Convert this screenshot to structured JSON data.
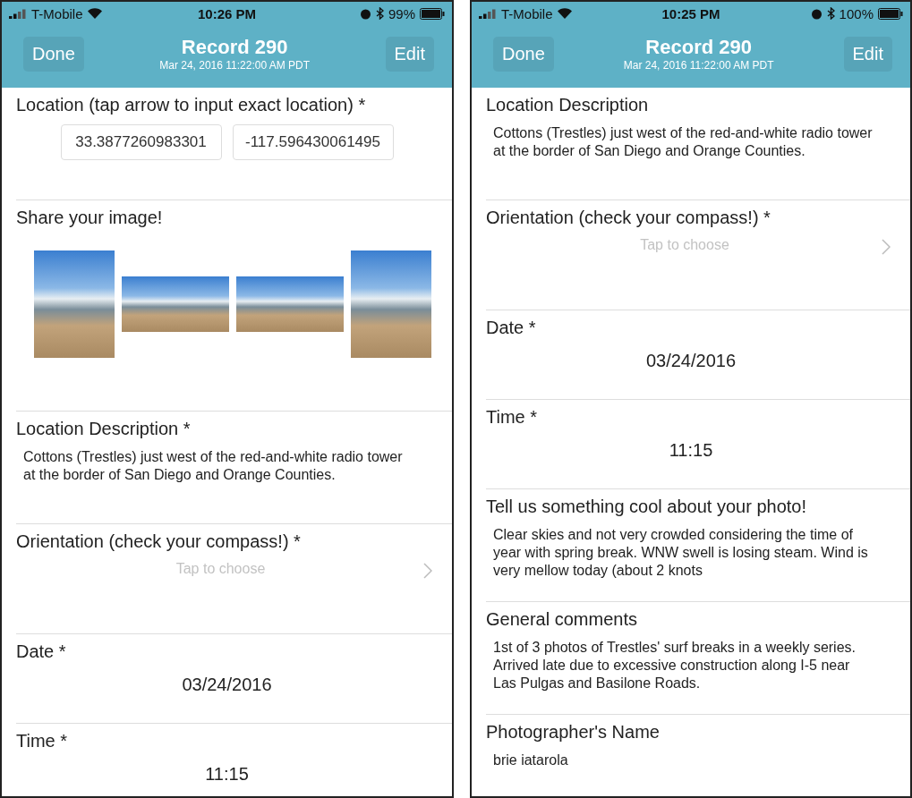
{
  "screens": [
    {
      "status_bar": {
        "carrier": "T-Mobile",
        "time": "10:26 PM",
        "battery": "99%"
      },
      "nav": {
        "left_button": "Done",
        "title": "Record 290",
        "subtitle": "Mar 24, 2016 11:22:00 AM PDT",
        "right_button": "Edit"
      },
      "fields": [
        {
          "kind": "coordinates",
          "label": "Location (tap arrow to input exact location) *",
          "values": [
            "33.3877260983301",
            "-117.596430061495"
          ]
        },
        {
          "kind": "images",
          "label": "Share your image!",
          "images": [
            {
              "kind": "square"
            },
            {
              "kind": "landscape"
            },
            {
              "kind": "landscape"
            },
            {
              "kind": "square"
            }
          ]
        },
        {
          "kind": "text",
          "label": "Location Description *",
          "value": "Cottons (Trestles) just west of the red-and-white radio tower at the border of San Diego and Orange Counties."
        },
        {
          "kind": "picker",
          "label": "Orientation (check your compass!) *",
          "placeholder": "Tap to choose"
        },
        {
          "kind": "value",
          "label": "Date *",
          "value": "03/24/2016"
        },
        {
          "kind": "value",
          "label": "Time *",
          "value": "11:15"
        }
      ]
    },
    {
      "status_bar": {
        "carrier": "T-Mobile",
        "time": "10:25 PM",
        "battery": "100%"
      },
      "nav": {
        "left_button": "Done",
        "title": "Record 290",
        "subtitle": "Mar 24, 2016 11:22:00 AM PDT",
        "right_button": "Edit"
      },
      "fields": [
        {
          "kind": "text",
          "label": "Location Description",
          "value": "Cottons (Trestles) just west of the red-and-white radio tower at the border of San Diego and Orange Counties."
        },
        {
          "kind": "picker",
          "label": "Orientation (check your compass!) *",
          "placeholder": "Tap to choose"
        },
        {
          "kind": "value",
          "label": "Date *",
          "value": "03/24/2016"
        },
        {
          "kind": "value",
          "label": "Time *",
          "value": "11:15"
        },
        {
          "kind": "text",
          "label": "Tell us something cool about your photo!",
          "value": "Clear skies and not very crowded considering the time of year with spring break. WNW swell is losing steam. Wind is very mellow today (about 2 knots"
        },
        {
          "kind": "text",
          "label": "General comments",
          "value": "1st of 3 photos of Trestles' surf breaks in a weekly series. Arrived late due to excessive construction along I-5 near Las Pulgas and Basilone Roads."
        },
        {
          "kind": "short",
          "label": "Photographer's Name",
          "value": "brie iatarola"
        }
      ]
    }
  ]
}
